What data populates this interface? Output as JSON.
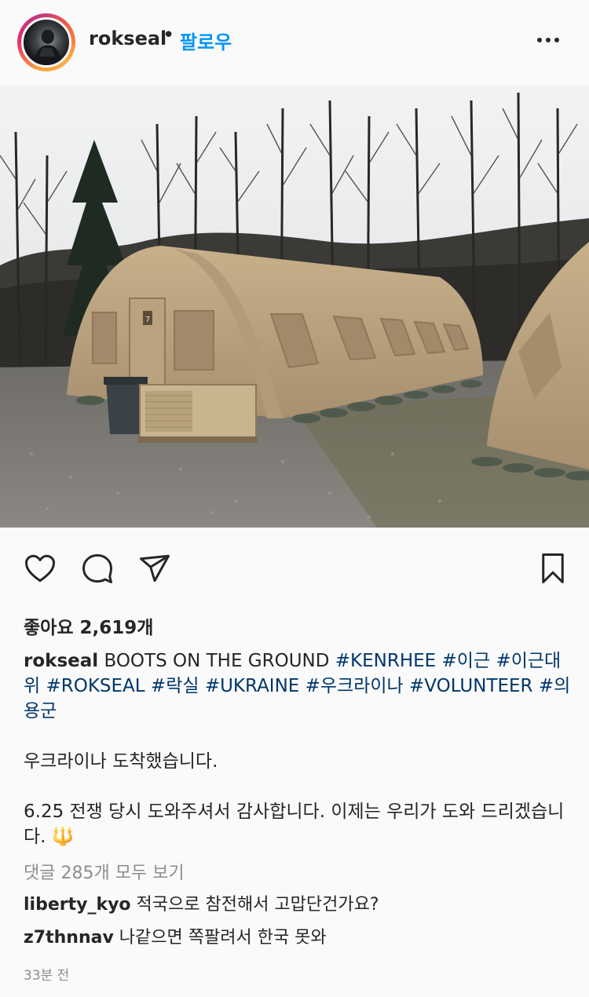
{
  "header": {
    "username": "rokseal",
    "separator": "•",
    "follow_label": "팔로우"
  },
  "photo": {
    "subject": "tan military arch tent among bare trees on gravel ground",
    "tent_label": "7"
  },
  "actions": {
    "like_icon": "heart-icon",
    "comment_icon": "comment-icon",
    "share_icon": "send-icon",
    "save_icon": "bookmark-icon"
  },
  "likes": {
    "text": "좋아요 2,619개"
  },
  "caption": {
    "username": "rokseal",
    "text": " BOOTS ON THE GROUND ",
    "hashtags": [
      "#KENRHEE",
      "#이근",
      "#이근대위",
      "#ROKSEAL",
      "#락실",
      "#UKRAINE",
      "#우크라이나",
      "#VOLUNTEER",
      "#의용군"
    ],
    "paragraph1": "우크라이나 도착했습니다.",
    "paragraph2": "6.25 전쟁 당시 도와주셔서 감사합니다. 이제는 우리가 도와 드리겠습니다. 🔱"
  },
  "comments": {
    "view_all": "댓글 285개 모두 보기",
    "items": [
      {
        "username": "liberty_kyo",
        "text": " 적국으로 참전해서 고맙단건가요?"
      },
      {
        "username": "z7thnnav",
        "text": " 나같으면 쪽팔려서 한국 못와"
      }
    ]
  },
  "timestamp": "33분 전",
  "colors": {
    "link_blue": "#0095f6",
    "hashtag_blue": "#00376b",
    "muted_gray": "#8e8e8e",
    "text": "#262626",
    "background": "#fafafa"
  }
}
